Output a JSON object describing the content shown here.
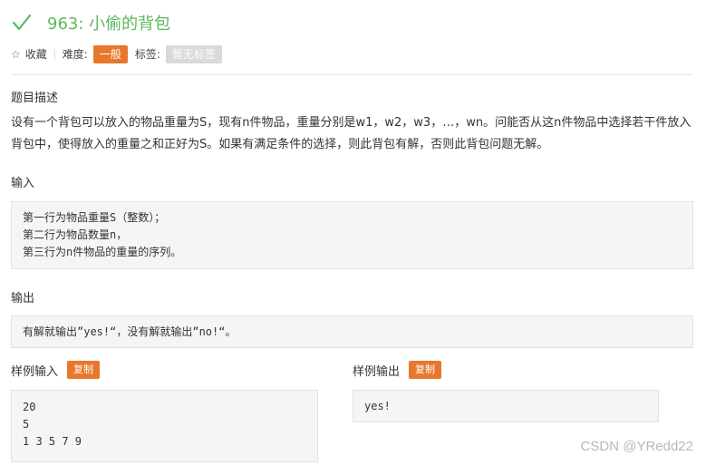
{
  "problem": {
    "title": "963: 小偷的背包",
    "status_color": "#5cb85c"
  },
  "meta": {
    "favorite_label": "收藏",
    "difficulty_label": "难度:",
    "difficulty_value": "一般",
    "tags_label": "标签:",
    "tags_value": "暂无标签"
  },
  "sections": {
    "description_title": "题目描述",
    "description_text": "设有一个背包可以放入的物品重量为S，现有n件物品，重量分别是w1，w2，w3，…，wn。问能否从这n件物品中选择若干件放入背包中，使得放入的重量之和正好为S。如果有满足条件的选择，则此背包有解，否则此背包问题无解。",
    "input_title": "输入",
    "input_lines": [
      "第一行为物品重量S（整数）；",
      "第二行为物品数量n，",
      "第三行为n件物品的重量的序列。"
    ],
    "output_title": "输出",
    "output_text": "有解就输出”yes!“，没有解就输出”no!“。"
  },
  "samples": {
    "input_title": "样例输入",
    "output_title": "样例输出",
    "copy_label": "复制",
    "input_lines": [
      "20",
      "5",
      "1 3 5 7 9"
    ],
    "output_lines": [
      "yes!"
    ]
  },
  "watermark": "CSDN @YRedd22",
  "colors": {
    "accent_orange": "#e8772e",
    "success_green": "#5cb85c",
    "tag_gray": "#d9d9d9"
  }
}
